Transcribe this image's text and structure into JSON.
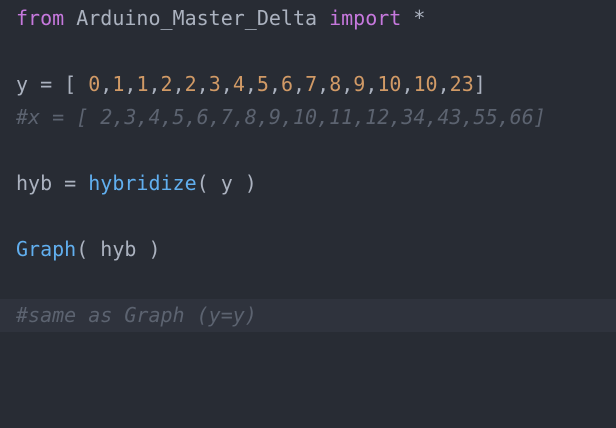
{
  "editor": {
    "lines": [
      {
        "tokens": [
          {
            "type": "kw",
            "text": "from"
          },
          {
            "type": "plain",
            "text": " Arduino_Master_Delta "
          },
          {
            "type": "kw",
            "text": "import"
          },
          {
            "type": "plain",
            "text": " *"
          }
        ]
      },
      {
        "tokens": []
      },
      {
        "tokens": [
          {
            "type": "plain",
            "text": "y = [ "
          },
          {
            "type": "num",
            "text": "0"
          },
          {
            "type": "plain",
            "text": ","
          },
          {
            "type": "num",
            "text": "1"
          },
          {
            "type": "plain",
            "text": ","
          },
          {
            "type": "num",
            "text": "1"
          },
          {
            "type": "plain",
            "text": ","
          },
          {
            "type": "num",
            "text": "2"
          },
          {
            "type": "plain",
            "text": ","
          },
          {
            "type": "num",
            "text": "2"
          },
          {
            "type": "plain",
            "text": ","
          },
          {
            "type": "num",
            "text": "3"
          },
          {
            "type": "plain",
            "text": ","
          },
          {
            "type": "num",
            "text": "4"
          },
          {
            "type": "plain",
            "text": ","
          },
          {
            "type": "num",
            "text": "5"
          },
          {
            "type": "plain",
            "text": ","
          },
          {
            "type": "num",
            "text": "6"
          },
          {
            "type": "plain",
            "text": ","
          },
          {
            "type": "num",
            "text": "7"
          },
          {
            "type": "plain",
            "text": ","
          },
          {
            "type": "num",
            "text": "8"
          },
          {
            "type": "plain",
            "text": ","
          },
          {
            "type": "num",
            "text": "9"
          },
          {
            "type": "plain",
            "text": ","
          },
          {
            "type": "num",
            "text": "10"
          },
          {
            "type": "plain",
            "text": ","
          },
          {
            "type": "num",
            "text": "10"
          },
          {
            "type": "plain",
            "text": ","
          },
          {
            "type": "num",
            "text": "23"
          },
          {
            "type": "plain",
            "text": "]"
          }
        ]
      },
      {
        "tokens": [
          {
            "type": "comment",
            "text": "#x = [ 2,3,4,5,6,7,8,9,10,11,12,34,43,55,66]"
          }
        ]
      },
      {
        "tokens": []
      },
      {
        "tokens": [
          {
            "type": "plain",
            "text": "hyb = "
          },
          {
            "type": "fn",
            "text": "hybridize"
          },
          {
            "type": "plain",
            "text": "( y )"
          }
        ]
      },
      {
        "tokens": []
      },
      {
        "tokens": [
          {
            "type": "fn",
            "text": "Graph"
          },
          {
            "type": "plain",
            "text": "( hyb )"
          }
        ]
      },
      {
        "tokens": []
      },
      {
        "active": true,
        "tokens": [
          {
            "type": "comment",
            "text": "#same as Graph (y=y)"
          }
        ]
      }
    ]
  },
  "colors": {
    "background": "#282c34",
    "active_line": "#2f333d",
    "keyword": "#c678dd",
    "number": "#d19a66",
    "function": "#61afef",
    "text": "#abb2bf",
    "comment": "#5c6370"
  }
}
